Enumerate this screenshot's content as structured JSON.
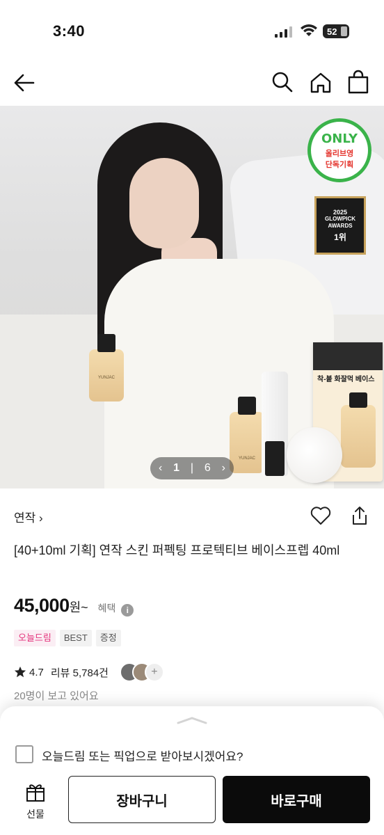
{
  "status_bar": {
    "time": "3:40",
    "battery": "52"
  },
  "nav": {
    "icons": [
      "back-arrow-icon",
      "search-icon",
      "home-icon",
      "shopping-bag-icon"
    ]
  },
  "hero": {
    "badge_only": {
      "line1": "ONLY",
      "line2": "올리브영",
      "line3": "단독기획"
    },
    "badge_glowpick": {
      "year": "2025",
      "line1": "GLOWPICK",
      "line2": "AWARDS",
      "rank": "1위"
    },
    "box_headline": "착-붙 화잘먹 베이스",
    "product_brand": "YUNJAC",
    "pager": {
      "current": "1",
      "separator": "|",
      "total": "6"
    }
  },
  "product": {
    "brand": "연작",
    "title": "[40+10ml 기획] 연작 스킨 퍼펙팅 프로텍티브 베이스프렙 40ml",
    "price": "45,000",
    "price_unit": "원~",
    "benefit_label": "혜택",
    "tags": [
      "오늘드림",
      "BEST",
      "증정"
    ],
    "rating": "4.7",
    "review_count": "리뷰 5,784건",
    "viewing": "20명이 보고 있어요"
  },
  "bottom_sheet": {
    "delivery_option": "오늘드림 또는 픽업으로 받아보시겠어요?",
    "gift_label": "선물",
    "cart_button": "장바구니",
    "buy_button": "바로구매"
  },
  "colors": {
    "accent_green": "#3ab34a",
    "tag_pink": "#e4337b",
    "buy_button": "#0b0b0b"
  }
}
